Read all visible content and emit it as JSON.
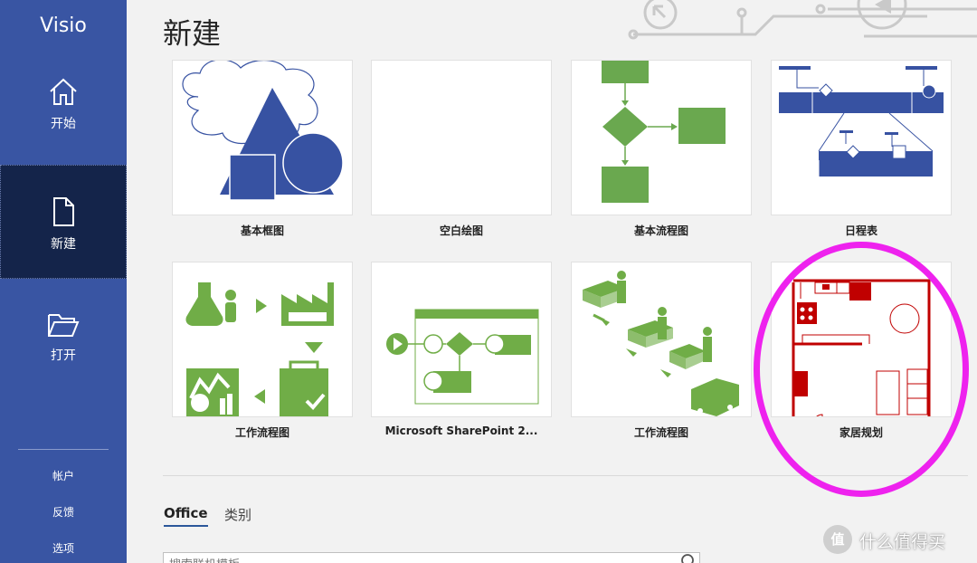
{
  "app": {
    "title": "Visio"
  },
  "nav": [
    {
      "label": "开始",
      "icon": "home-icon"
    },
    {
      "label": "新建",
      "icon": "new-document-icon",
      "active": true
    },
    {
      "label": "打开",
      "icon": "open-folder-icon"
    }
  ],
  "bottom_links": [
    "帐户",
    "反馈",
    "选项"
  ],
  "page_title": "新建",
  "templates": [
    {
      "label": "基本框图",
      "thumb": "basic-diagram-thumbnail"
    },
    {
      "label": "空白绘图",
      "thumb": "blank-drawing-thumbnail"
    },
    {
      "label": "基本流程图",
      "thumb": "basic-flowchart-thumbnail"
    },
    {
      "label": "日程表",
      "thumb": "timeline-thumbnail"
    },
    {
      "label": "工作流程图",
      "thumb": "work-flow-diagram-thumbnail"
    },
    {
      "label": "Microsoft SharePoint 2...",
      "thumb": "sharepoint-workflow-thumbnail"
    },
    {
      "label": "工作流程图",
      "thumb": "3d-work-flow-thumbnail"
    },
    {
      "label": "家居规划",
      "thumb": "home-plan-thumbnail"
    }
  ],
  "tabs": [
    {
      "label": "Office",
      "active": true
    },
    {
      "label": "类别",
      "active": false
    }
  ],
  "search": {
    "placeholder": "搜索联机模板"
  },
  "watermark": {
    "badge": "值",
    "text": "什么值得买"
  },
  "colors": {
    "sidebar": "#3955a3",
    "sidebar_active": "#14244a",
    "shape_blue": "#3752a2",
    "flow_green": "#6aa84f",
    "workflow_green": "#70ad47",
    "plan_red": "#c00000",
    "highlight_magenta": "#ee22ee"
  }
}
